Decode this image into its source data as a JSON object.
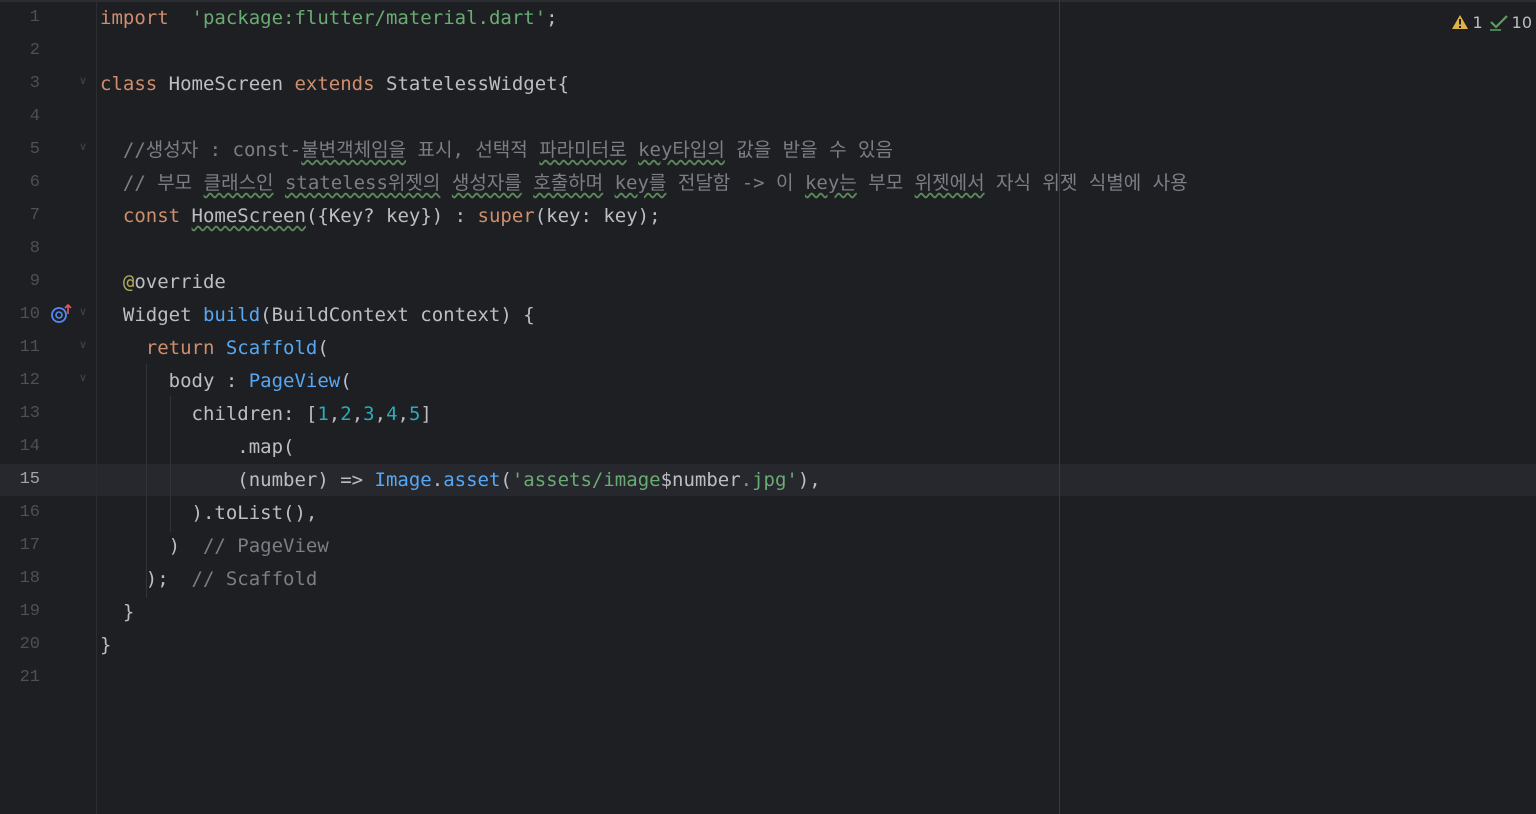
{
  "status": {
    "warnings": "1",
    "checks": "10"
  },
  "gutter_icon": "override-method-icon",
  "lines": [
    {
      "n": "1",
      "t": [
        [
          "kw",
          "import"
        ],
        [
          "",
          "  "
        ],
        [
          "str",
          "'package:flutter/material.dart'"
        ],
        [
          "",
          ";"
        ]
      ]
    },
    {
      "n": "2",
      "t": []
    },
    {
      "n": "3",
      "t": [
        [
          "kw",
          "class"
        ],
        [
          "",
          " HomeScreen "
        ],
        [
          "kw",
          "extends"
        ],
        [
          "",
          " StatelessWidget{"
        ]
      ]
    },
    {
      "n": "4",
      "t": []
    },
    {
      "n": "5",
      "t": [
        [
          "cmt",
          "  //생성자 : const-"
        ],
        [
          "cmt wavy",
          "불변객체임을"
        ],
        [
          "cmt",
          " 표시, 선택적 "
        ],
        [
          "cmt wavy",
          "파라미터로"
        ],
        [
          "cmt",
          " "
        ],
        [
          "cmt wavy",
          "key타입의"
        ],
        [
          "cmt",
          " 값을 받을 수 있음"
        ]
      ]
    },
    {
      "n": "6",
      "t": [
        [
          "cmt",
          "  // 부모 "
        ],
        [
          "cmt wavy",
          "클래스인"
        ],
        [
          "cmt",
          " "
        ],
        [
          "cmt wavy",
          "stateless위젯의"
        ],
        [
          "cmt",
          " "
        ],
        [
          "cmt wavy",
          "생성자를"
        ],
        [
          "cmt",
          " "
        ],
        [
          "cmt wavy",
          "호출하며"
        ],
        [
          "cmt",
          " "
        ],
        [
          "cmt wavy",
          "key를"
        ],
        [
          "cmt",
          " 전달함 -> 이 "
        ],
        [
          "cmt wavy",
          "key는"
        ],
        [
          "cmt",
          " 부모 "
        ],
        [
          "cmt wavy",
          "위젯에서"
        ],
        [
          "cmt",
          " 자식 위젯 식별에 사용"
        ]
      ]
    },
    {
      "n": "7",
      "t": [
        [
          "",
          "  "
        ],
        [
          "kw",
          "const"
        ],
        [
          "",
          " "
        ],
        [
          "wavy",
          "HomeScreen"
        ],
        [
          "",
          "({Key? key}) : "
        ],
        [
          "kw",
          "super"
        ],
        [
          "",
          "(key: key);"
        ]
      ]
    },
    {
      "n": "8",
      "t": []
    },
    {
      "n": "9",
      "t": [
        [
          "",
          "  "
        ],
        [
          "ann",
          "@"
        ],
        [
          "",
          "override"
        ]
      ]
    },
    {
      "n": "10",
      "t": [
        [
          "",
          "  Widget "
        ],
        [
          "fn",
          "build"
        ],
        [
          "",
          "(BuildContext context) {"
        ]
      ]
    },
    {
      "n": "11",
      "t": [
        [
          "",
          "    "
        ],
        [
          "kw",
          "return"
        ],
        [
          "",
          " "
        ],
        [
          "fn",
          "Scaffold"
        ],
        [
          "",
          "("
        ]
      ]
    },
    {
      "n": "12",
      "t": [
        [
          "",
          "      body : "
        ],
        [
          "fn",
          "PageView"
        ],
        [
          "",
          "("
        ]
      ]
    },
    {
      "n": "13",
      "t": [
        [
          "",
          "        children: ["
        ],
        [
          "num",
          "1"
        ],
        [
          "",
          ","
        ],
        [
          "num",
          "2"
        ],
        [
          "",
          ","
        ],
        [
          "num",
          "3"
        ],
        [
          "",
          ","
        ],
        [
          "num",
          "4"
        ],
        [
          "",
          ","
        ],
        [
          "num",
          "5"
        ],
        [
          "",
          "]"
        ]
      ]
    },
    {
      "n": "14",
      "t": [
        [
          "",
          "            .map("
        ]
      ]
    },
    {
      "n": "15",
      "t": [
        [
          "",
          "            (number) => "
        ],
        [
          "fn",
          "Image"
        ],
        [
          "",
          "."
        ],
        [
          "fn",
          "asset"
        ],
        [
          "",
          "("
        ],
        [
          "str",
          "'assets/image"
        ],
        [
          "",
          "$number"
        ],
        [
          "str",
          ".jpg'"
        ],
        [
          "",
          "),"
        ]
      ]
    },
    {
      "n": "16",
      "t": [
        [
          "",
          "        ).toList(),"
        ]
      ]
    },
    {
      "n": "17",
      "t": [
        [
          "",
          "      )  "
        ],
        [
          "cmt",
          "// PageView"
        ]
      ]
    },
    {
      "n": "18",
      "t": [
        [
          "",
          "    );  "
        ],
        [
          "cmt",
          "// Scaffold"
        ]
      ]
    },
    {
      "n": "19",
      "t": [
        [
          "",
          "  }"
        ]
      ]
    },
    {
      "n": "20",
      "t": [
        [
          "",
          "}"
        ]
      ]
    },
    {
      "n": "21",
      "t": []
    }
  ],
  "active_line": "15"
}
